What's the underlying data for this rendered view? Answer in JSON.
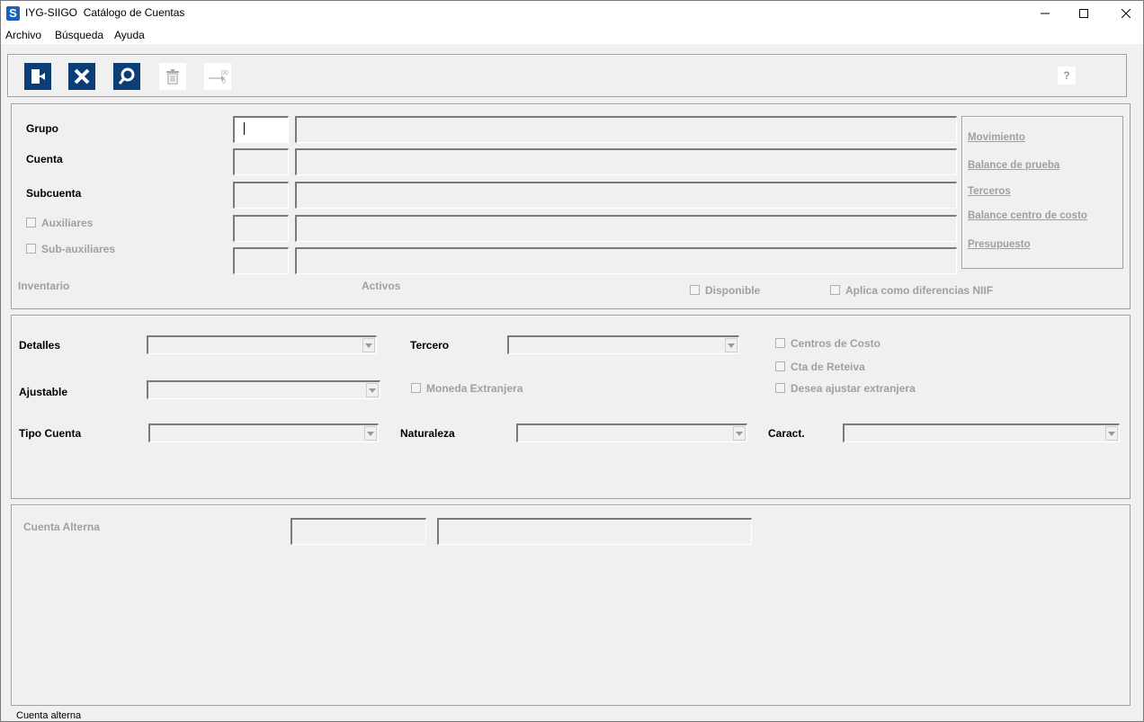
{
  "window": {
    "app_name": "IYG-SIIGO",
    "title": "Catálogo de Cuentas",
    "icon_letter": "S"
  },
  "menu": [
    "Archivo",
    "Búsqueda",
    "Ayuda"
  ],
  "toolbar": {
    "help_label": "?"
  },
  "account_section": {
    "grupo_label": "Grupo",
    "cuenta_label": "Cuenta",
    "subcuenta_label": "Subcuenta",
    "auxiliares_label": "Auxiliares",
    "subauxiliares_label": "Sub-auxiliares",
    "inventario_label": "Inventario",
    "activos_label": "Activos",
    "disponible_label": "Disponible",
    "niif_label": "Aplica como diferencias NIIF",
    "fields": {
      "grupo_code": "",
      "grupo_desc": "",
      "cuenta_code": "",
      "cuenta_desc": "",
      "subcuenta_code": "",
      "subcuenta_desc": "",
      "auxiliar_code": "",
      "auxiliar_desc": "",
      "subauxiliar_code": "",
      "subauxiliar_desc": ""
    }
  },
  "links": [
    "Movimiento",
    "Balance de prueba",
    "Terceros",
    "Balance centro de costo",
    "Presupuesto"
  ],
  "details_section": {
    "detalles_label": "Detalles",
    "tercero_label": "Tercero",
    "ajustable_label": "Ajustable",
    "moneda_label": "Moneda Extranjera",
    "tipo_cuenta_label": "Tipo Cuenta",
    "naturaleza_label": "Naturaleza",
    "caract_label": "Caract.",
    "centros_label": "Centros de Costo",
    "reteiva_label": "Cta de Reteiva",
    "ajustar_label": "Desea ajustar extranjera"
  },
  "alt_section": {
    "label": "Cuenta Alterna",
    "code": "",
    "desc": ""
  },
  "status": "Cuenta alterna"
}
